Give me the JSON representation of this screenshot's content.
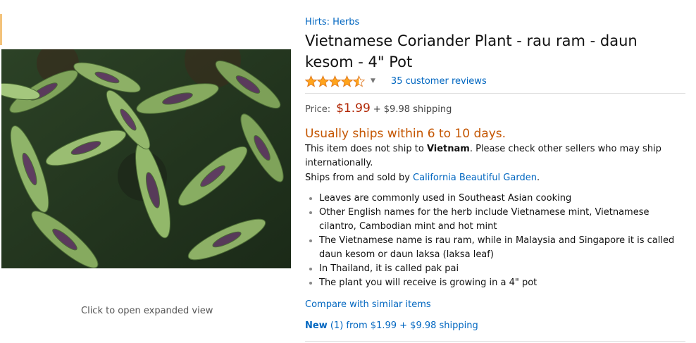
{
  "image": {
    "expand_text": "Click to open expanded view"
  },
  "product": {
    "brand": "Hirts: Herbs",
    "title": "Vietnamese Coriander Plant - rau ram - daun kesom - 4\" Pot",
    "rating": 4.5,
    "rating_max": 5,
    "reviews": "35 customer reviews"
  },
  "price": {
    "label": "Price:",
    "amount": "$1.99",
    "shipping": "+ $9.98 shipping"
  },
  "availability": {
    "status": "Usually ships within 6 to 10 days.",
    "note_prefix": "This item does not ship to ",
    "country": "Vietnam",
    "note_suffix": ". Please check other sellers who may ship internationally.",
    "ships_from_prefix": "Ships from and sold by ",
    "seller": "California Beautiful Garden",
    "ships_from_suffix": "."
  },
  "bullets": [
    "Leaves are commonly used in Southeast Asian cooking",
    "Other English names for the herb include Vietnamese mint, Vietnamese cilantro, Cambodian mint and hot mint",
    "The Vietnamese name is rau ram, while in Malaysia and Singapore it is called daun kesom or daun laksa (laksa leaf)",
    "In Thailand, it is called pak pai",
    "The plant you will receive is growing in a 4\" pot"
  ],
  "compare_link": "Compare with similar items",
  "offers": {
    "condition": "New",
    "count": "(1)",
    "from_text": "from $1.99 + $9.98 shipping"
  },
  "colors": {
    "link": "#0066c0",
    "price": "#b12704",
    "availability": "#c45500",
    "star": "#ffa41c"
  }
}
